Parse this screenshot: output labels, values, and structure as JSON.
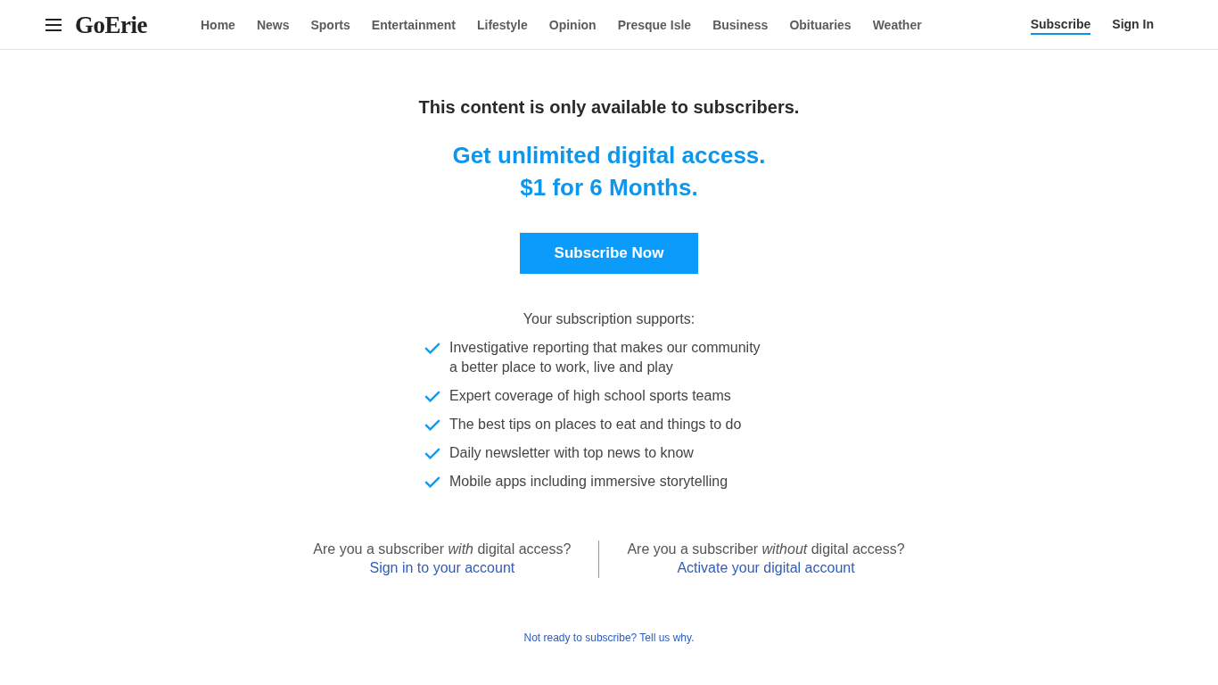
{
  "header": {
    "logo": "GoErie",
    "nav": [
      {
        "label": "Home"
      },
      {
        "label": "News"
      },
      {
        "label": "Sports"
      },
      {
        "label": "Entertainment"
      },
      {
        "label": "Lifestyle"
      },
      {
        "label": "Opinion"
      },
      {
        "label": "Presque Isle"
      },
      {
        "label": "Business"
      },
      {
        "label": "Obituaries"
      },
      {
        "label": "Weather"
      }
    ],
    "account_links": [
      {
        "label": "Subscribe",
        "selected": true
      },
      {
        "label": "Sign In",
        "selected": false
      }
    ]
  },
  "paywall": {
    "notice": "This content is only available to subscribers.",
    "offer_lines": [
      "Get unlimited digital access.",
      "$1 for 6 Months."
    ],
    "cta_button": "Subscribe Now",
    "benefits_title": "Your subscription supports:",
    "benefits": [
      "Investigative reporting that makes our community a better place to work, live and play",
      "Expert coverage of high school sports teams",
      "The best tips on places to eat and things to do",
      "Daily newsletter with top news to know",
      "Mobile apps including immersive storytelling"
    ],
    "account_options": [
      {
        "question": "Are you a subscriber *with* digital access?",
        "link": "Sign in to your account"
      },
      {
        "question": "Are you a subscriber *without* digital access?",
        "link": "Activate your digital account"
      }
    ],
    "feedback_link": "Not ready to subscribe? Tell us why."
  }
}
